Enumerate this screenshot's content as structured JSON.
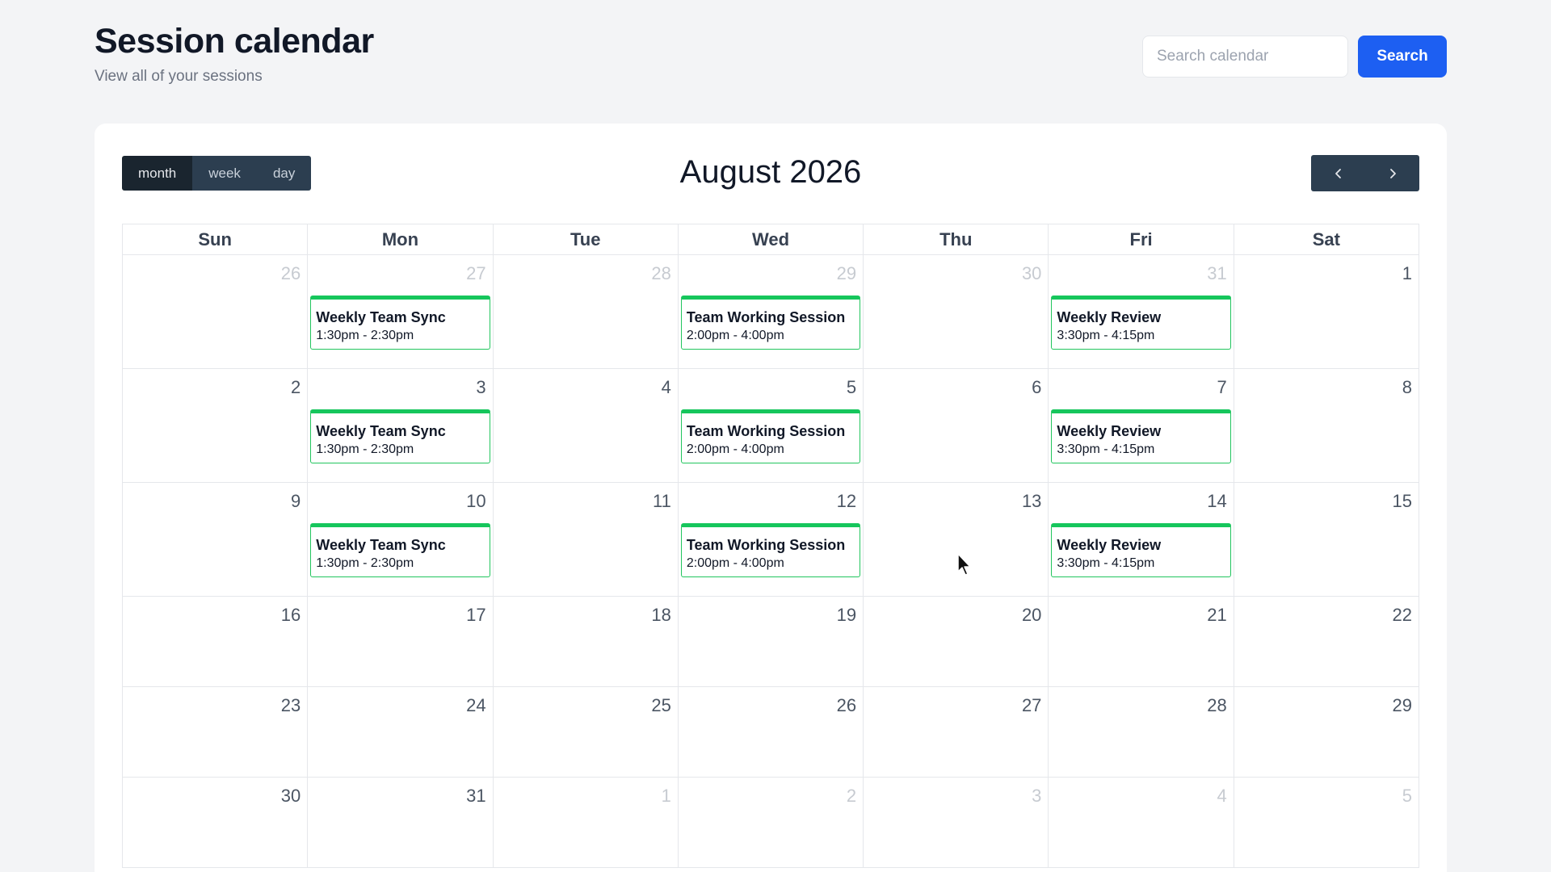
{
  "header": {
    "title": "Session calendar",
    "subtitle": "View all of your sessions"
  },
  "search": {
    "placeholder": "Search calendar",
    "value": "",
    "button_label": "Search"
  },
  "toolbar": {
    "views": [
      "month",
      "week",
      "day"
    ],
    "active_view": "month",
    "title": "August 2026",
    "prev_icon": "chevron-left-icon",
    "next_icon": "chevron-right-icon"
  },
  "calendar": {
    "weekdays": [
      "Sun",
      "Mon",
      "Tue",
      "Wed",
      "Thu",
      "Fri",
      "Sat"
    ],
    "weeks": [
      [
        {
          "day": "26",
          "other": true
        },
        {
          "day": "27",
          "other": true,
          "event": {
            "title": "Weekly Team Sync",
            "time": "1:30pm - 2:30pm"
          }
        },
        {
          "day": "28",
          "other": true
        },
        {
          "day": "29",
          "other": true,
          "event": {
            "title": "Team Working Session",
            "time": "2:00pm - 4:00pm"
          }
        },
        {
          "day": "30",
          "other": true
        },
        {
          "day": "31",
          "other": true,
          "event": {
            "title": "Weekly Review",
            "time": "3:30pm - 4:15pm"
          }
        },
        {
          "day": "1",
          "other": false
        }
      ],
      [
        {
          "day": "2",
          "other": false
        },
        {
          "day": "3",
          "other": false,
          "event": {
            "title": "Weekly Team Sync",
            "time": "1:30pm - 2:30pm"
          }
        },
        {
          "day": "4",
          "other": false
        },
        {
          "day": "5",
          "other": false,
          "event": {
            "title": "Team Working Session",
            "time": "2:00pm - 4:00pm"
          }
        },
        {
          "day": "6",
          "other": false
        },
        {
          "day": "7",
          "other": false,
          "event": {
            "title": "Weekly Review",
            "time": "3:30pm - 4:15pm"
          }
        },
        {
          "day": "8",
          "other": false
        }
      ],
      [
        {
          "day": "9",
          "other": false
        },
        {
          "day": "10",
          "other": false,
          "event": {
            "title": "Weekly Team Sync",
            "time": "1:30pm - 2:30pm"
          }
        },
        {
          "day": "11",
          "other": false
        },
        {
          "day": "12",
          "other": false,
          "event": {
            "title": "Team Working Session",
            "time": "2:00pm - 4:00pm"
          }
        },
        {
          "day": "13",
          "other": false
        },
        {
          "day": "14",
          "other": false,
          "event": {
            "title": "Weekly Review",
            "time": "3:30pm - 4:15pm"
          }
        },
        {
          "day": "15",
          "other": false
        }
      ],
      [
        {
          "day": "16",
          "other": false
        },
        {
          "day": "17",
          "other": false
        },
        {
          "day": "18",
          "other": false
        },
        {
          "day": "19",
          "other": false
        },
        {
          "day": "20",
          "other": false
        },
        {
          "day": "21",
          "other": false
        },
        {
          "day": "22",
          "other": false
        }
      ],
      [
        {
          "day": "23",
          "other": false
        },
        {
          "day": "24",
          "other": false
        },
        {
          "day": "25",
          "other": false
        },
        {
          "day": "26",
          "other": false
        },
        {
          "day": "27",
          "other": false
        },
        {
          "day": "28",
          "other": false
        },
        {
          "day": "29",
          "other": false
        }
      ],
      [
        {
          "day": "30",
          "other": false
        },
        {
          "day": "31",
          "other": false
        },
        {
          "day": "1",
          "other": true
        },
        {
          "day": "2",
          "other": true
        },
        {
          "day": "3",
          "other": true
        },
        {
          "day": "4",
          "other": true
        },
        {
          "day": "5",
          "other": true
        }
      ]
    ]
  },
  "colors": {
    "accent": "#1d5ff2",
    "event_border": "#16c65c",
    "toolbar_button": "#2c3e50"
  }
}
